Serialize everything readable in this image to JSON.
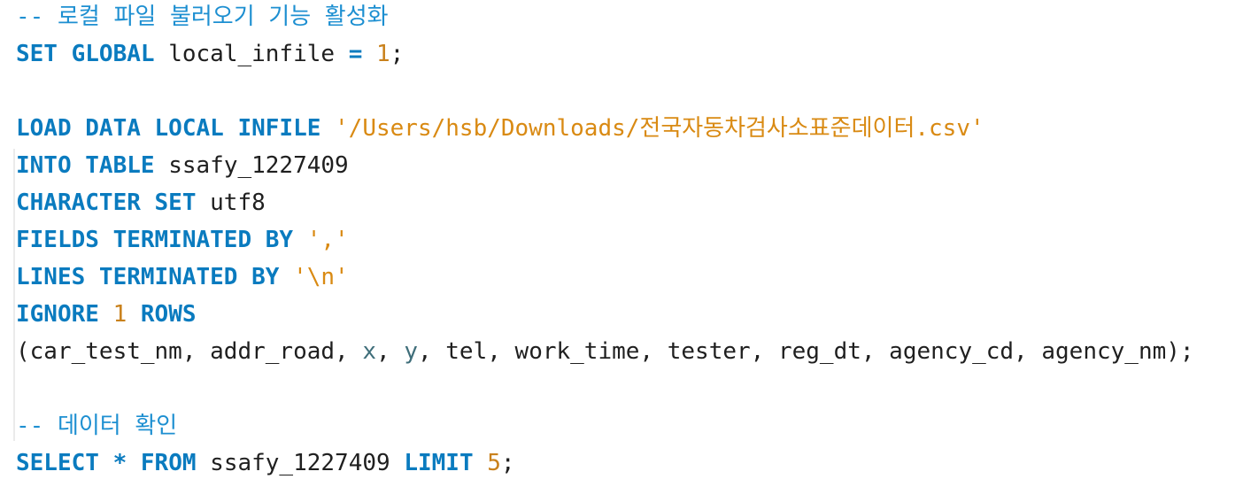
{
  "lines": [
    {
      "tokens": [
        {
          "type": "comment",
          "text": "-- 로컬 파일 불러오기 기능 활성화"
        }
      ]
    },
    {
      "tokens": [
        {
          "type": "keyword",
          "text": "SET"
        },
        {
          "type": "text",
          "text": " "
        },
        {
          "type": "keyword",
          "text": "GLOBAL"
        },
        {
          "type": "text",
          "text": " local_infile "
        },
        {
          "type": "keyword",
          "text": "="
        },
        {
          "type": "text",
          "text": " "
        },
        {
          "type": "number",
          "text": "1"
        },
        {
          "type": "text",
          "text": ";"
        }
      ]
    },
    {
      "tokens": []
    },
    {
      "tokens": [
        {
          "type": "keyword",
          "text": "LOAD DATA LOCAL INFILE"
        },
        {
          "type": "text",
          "text": " "
        },
        {
          "type": "string",
          "text": "'/Users/hsb/Downloads/전국자동차검사소표준데이터.csv'"
        }
      ]
    },
    {
      "tokens": [
        {
          "type": "keyword",
          "text": "INTO TABLE"
        },
        {
          "type": "text",
          "text": " ssafy_1227409"
        }
      ]
    },
    {
      "tokens": [
        {
          "type": "keyword",
          "text": "CHARACTER SET"
        },
        {
          "type": "text",
          "text": " utf8"
        }
      ]
    },
    {
      "tokens": [
        {
          "type": "keyword",
          "text": "FIELDS TERMINATED BY"
        },
        {
          "type": "text",
          "text": " "
        },
        {
          "type": "string",
          "text": "','"
        }
      ]
    },
    {
      "tokens": [
        {
          "type": "keyword",
          "text": "LINES TERMINATED BY"
        },
        {
          "type": "text",
          "text": " "
        },
        {
          "type": "string",
          "text": "'\\n'"
        }
      ]
    },
    {
      "tokens": [
        {
          "type": "keyword",
          "text": "IGNORE"
        },
        {
          "type": "text",
          "text": " "
        },
        {
          "type": "number",
          "text": "1"
        },
        {
          "type": "text",
          "text": " "
        },
        {
          "type": "keyword",
          "text": "ROWS"
        }
      ]
    },
    {
      "tokens": [
        {
          "type": "text",
          "text": "(car_test_nm, addr_road, "
        },
        {
          "type": "variable",
          "text": "x"
        },
        {
          "type": "text",
          "text": ", "
        },
        {
          "type": "variable",
          "text": "y"
        },
        {
          "type": "text",
          "text": ", tel, work_time, tester, reg_dt, agency_cd, agency_nm);"
        }
      ]
    },
    {
      "tokens": []
    },
    {
      "tokens": [
        {
          "type": "comment",
          "text": "-- 데이터 확인"
        }
      ]
    },
    {
      "tokens": [
        {
          "type": "keyword",
          "text": "SELECT"
        },
        {
          "type": "text",
          "text": " "
        },
        {
          "type": "keyword",
          "text": "*"
        },
        {
          "type": "text",
          "text": " "
        },
        {
          "type": "keyword",
          "text": "FROM"
        },
        {
          "type": "text",
          "text": " ssafy_1227409 "
        },
        {
          "type": "keyword",
          "text": "LIMIT"
        },
        {
          "type": "text",
          "text": " "
        },
        {
          "type": "number",
          "text": "5"
        },
        {
          "type": "text",
          "text": ";"
        }
      ]
    }
  ],
  "colors": {
    "keyword": "#0a7bbf",
    "comment": "#1d8fd1",
    "string": "#d98a13",
    "number": "#c9811c",
    "variable": "#3f6e7a",
    "text": "#1f1f1f",
    "background": "#ffffff"
  }
}
